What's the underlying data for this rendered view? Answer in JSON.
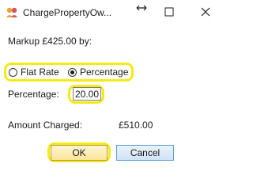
{
  "window": {
    "title": "ChargePropertyOw...",
    "resize_icon": "resize-arrows-icon",
    "controls": {
      "minimize_icon": "minimize-icon",
      "maximize_icon": "maximize-icon",
      "close_icon": "close-icon"
    }
  },
  "form": {
    "markup_label": "Markup £425.00 by:",
    "rate_type": {
      "options": [
        {
          "label": "Flat Rate",
          "checked": false
        },
        {
          "label": "Percentage",
          "checked": true
        }
      ]
    },
    "percentage_label": "Percentage:",
    "percentage_value": "20.00",
    "amount_label": "Amount Charged:",
    "amount_value": "£510.00"
  },
  "buttons": {
    "ok_label": "OK",
    "cancel_label": "Cancel"
  },
  "colors": {
    "highlight": "#f5ea14",
    "ok_button": "#fbe39a",
    "cancel_border": "#5b9bd5"
  }
}
